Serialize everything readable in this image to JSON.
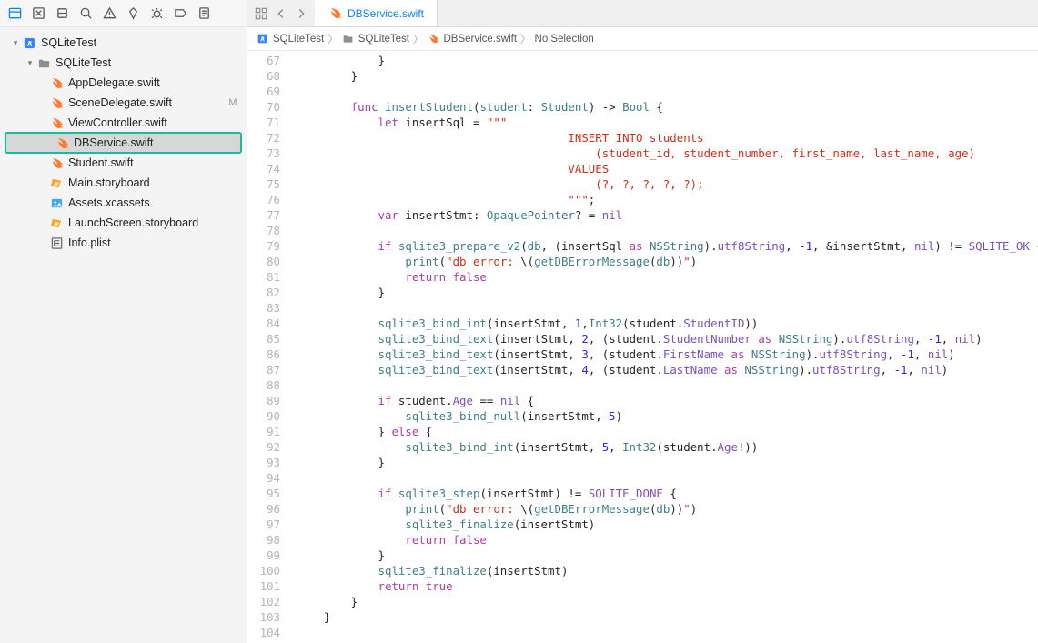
{
  "sidebar": {
    "project": "SQLiteTest",
    "group": "SQLiteTest",
    "files": [
      {
        "name": "AppDelegate.swift",
        "kind": "swift",
        "modified": false
      },
      {
        "name": "SceneDelegate.swift",
        "kind": "swift",
        "modified": true
      },
      {
        "name": "ViewController.swift",
        "kind": "swift",
        "modified": false
      },
      {
        "name": "DBService.swift",
        "kind": "swift",
        "modified": false,
        "selected": true,
        "highlight": true
      },
      {
        "name": "Student.swift",
        "kind": "swift",
        "modified": false
      },
      {
        "name": "Main.storyboard",
        "kind": "storyboard",
        "modified": false
      },
      {
        "name": "Assets.xcassets",
        "kind": "assets",
        "modified": false
      },
      {
        "name": "LaunchScreen.storyboard",
        "kind": "storyboard",
        "modified": false
      },
      {
        "name": "Info.plist",
        "kind": "plist",
        "modified": false
      }
    ]
  },
  "tab": {
    "label": "DBService.swift"
  },
  "breadcrumb": {
    "items": [
      {
        "label": "SQLiteTest",
        "icon": "project"
      },
      {
        "label": "SQLiteTest",
        "icon": "folder"
      },
      {
        "label": "DBService.swift",
        "icon": "swift"
      },
      {
        "label": "No Selection",
        "icon": null
      }
    ]
  },
  "editor": {
    "first_line_number": 67,
    "lines": [
      {
        "n": 67,
        "ind": 12,
        "tokens": [
          [
            "plain",
            "}"
          ]
        ]
      },
      {
        "n": 68,
        "ind": 8,
        "tokens": [
          [
            "plain",
            "}"
          ]
        ]
      },
      {
        "n": 69,
        "ind": 0,
        "tokens": []
      },
      {
        "n": 70,
        "ind": 8,
        "tokens": [
          [
            "kw",
            "func"
          ],
          [
            "plain",
            " "
          ],
          [
            "fn",
            "insertStudent"
          ],
          [
            "plain",
            "("
          ],
          [
            "fn",
            "student"
          ],
          [
            "plain",
            ": "
          ],
          [
            "type",
            "Student"
          ],
          [
            "plain",
            ") -> "
          ],
          [
            "type",
            "Bool"
          ],
          [
            "plain",
            " {"
          ]
        ]
      },
      {
        "n": 71,
        "ind": 12,
        "tokens": [
          [
            "kw",
            "let"
          ],
          [
            "plain",
            " insertSql = "
          ],
          [
            "str",
            "\"\"\""
          ]
        ]
      },
      {
        "n": 72,
        "ind": 40,
        "tokens": [
          [
            "str",
            "INSERT INTO students"
          ]
        ]
      },
      {
        "n": 73,
        "ind": 44,
        "tokens": [
          [
            "str",
            "(student_id, student_number, first_name, last_name, age)"
          ]
        ]
      },
      {
        "n": 74,
        "ind": 40,
        "tokens": [
          [
            "str",
            "VALUES"
          ]
        ]
      },
      {
        "n": 75,
        "ind": 44,
        "tokens": [
          [
            "str",
            "(?, ?, ?, ?, ?);"
          ]
        ]
      },
      {
        "n": 76,
        "ind": 40,
        "tokens": [
          [
            "str",
            "\"\"\""
          ],
          [
            "plain",
            ";"
          ]
        ]
      },
      {
        "n": 77,
        "ind": 12,
        "tokens": [
          [
            "kw",
            "var"
          ],
          [
            "plain",
            " insertStmt: "
          ],
          [
            "type",
            "OpaquePointer"
          ],
          [
            "plain",
            "? = "
          ],
          [
            "const",
            "nil"
          ]
        ]
      },
      {
        "n": 78,
        "ind": 0,
        "tokens": []
      },
      {
        "n": 79,
        "ind": 12,
        "tokens": [
          [
            "kw",
            "if"
          ],
          [
            "plain",
            " "
          ],
          [
            "fn",
            "sqlite3_prepare_v2"
          ],
          [
            "plain",
            "("
          ],
          [
            "fn",
            "db"
          ],
          [
            "plain",
            ", (insertSql "
          ],
          [
            "kw",
            "as"
          ],
          [
            "plain",
            " "
          ],
          [
            "type",
            "NSString"
          ],
          [
            "plain",
            ")."
          ],
          [
            "member",
            "utf8String"
          ],
          [
            "plain",
            ", "
          ],
          [
            "num",
            "-1"
          ],
          [
            "plain",
            ", &insertStmt, "
          ],
          [
            "const",
            "nil"
          ],
          [
            "plain",
            ") != "
          ],
          [
            "const",
            "SQLITE_OK"
          ],
          [
            "plain",
            " {"
          ]
        ]
      },
      {
        "n": 80,
        "ind": 16,
        "tokens": [
          [
            "fn",
            "print"
          ],
          [
            "plain",
            "("
          ],
          [
            "str",
            "\"db error: "
          ],
          [
            "plain",
            "\\("
          ],
          [
            "fn",
            "getDBErrorMessage"
          ],
          [
            "plain",
            "("
          ],
          [
            "fn",
            "db"
          ],
          [
            "plain",
            "))"
          ],
          [
            "str",
            "\""
          ],
          [
            "plain",
            ")"
          ]
        ]
      },
      {
        "n": 81,
        "ind": 16,
        "tokens": [
          [
            "kw",
            "return"
          ],
          [
            "plain",
            " "
          ],
          [
            "kw",
            "false"
          ]
        ]
      },
      {
        "n": 82,
        "ind": 12,
        "tokens": [
          [
            "plain",
            "}"
          ]
        ]
      },
      {
        "n": 83,
        "ind": 0,
        "tokens": []
      },
      {
        "n": 84,
        "ind": 12,
        "tokens": [
          [
            "fn",
            "sqlite3_bind_int"
          ],
          [
            "plain",
            "(insertStmt, "
          ],
          [
            "num",
            "1"
          ],
          [
            "plain",
            ","
          ],
          [
            "type",
            "Int32"
          ],
          [
            "plain",
            "(student."
          ],
          [
            "member",
            "StudentID"
          ],
          [
            "plain",
            "))"
          ]
        ]
      },
      {
        "n": 85,
        "ind": 12,
        "tokens": [
          [
            "fn",
            "sqlite3_bind_text"
          ],
          [
            "plain",
            "(insertStmt, "
          ],
          [
            "num",
            "2"
          ],
          [
            "plain",
            ", (student."
          ],
          [
            "member",
            "StudentNumber"
          ],
          [
            "plain",
            " "
          ],
          [
            "kw",
            "as"
          ],
          [
            "plain",
            " "
          ],
          [
            "type",
            "NSString"
          ],
          [
            "plain",
            ")."
          ],
          [
            "member",
            "utf8String"
          ],
          [
            "plain",
            ", "
          ],
          [
            "num",
            "-1"
          ],
          [
            "plain",
            ", "
          ],
          [
            "const",
            "nil"
          ],
          [
            "plain",
            ")"
          ]
        ]
      },
      {
        "n": 86,
        "ind": 12,
        "tokens": [
          [
            "fn",
            "sqlite3_bind_text"
          ],
          [
            "plain",
            "(insertStmt, "
          ],
          [
            "num",
            "3"
          ],
          [
            "plain",
            ", (student."
          ],
          [
            "member",
            "FirstName"
          ],
          [
            "plain",
            " "
          ],
          [
            "kw",
            "as"
          ],
          [
            "plain",
            " "
          ],
          [
            "type",
            "NSString"
          ],
          [
            "plain",
            ")."
          ],
          [
            "member",
            "utf8String"
          ],
          [
            "plain",
            ", "
          ],
          [
            "num",
            "-1"
          ],
          [
            "plain",
            ", "
          ],
          [
            "const",
            "nil"
          ],
          [
            "plain",
            ")"
          ]
        ]
      },
      {
        "n": 87,
        "ind": 12,
        "tokens": [
          [
            "fn",
            "sqlite3_bind_text"
          ],
          [
            "plain",
            "(insertStmt, "
          ],
          [
            "num",
            "4"
          ],
          [
            "plain",
            ", (student."
          ],
          [
            "member",
            "LastName"
          ],
          [
            "plain",
            " "
          ],
          [
            "kw",
            "as"
          ],
          [
            "plain",
            " "
          ],
          [
            "type",
            "NSString"
          ],
          [
            "plain",
            ")."
          ],
          [
            "member",
            "utf8String"
          ],
          [
            "plain",
            ", "
          ],
          [
            "num",
            "-1"
          ],
          [
            "plain",
            ", "
          ],
          [
            "const",
            "nil"
          ],
          [
            "plain",
            ")"
          ]
        ]
      },
      {
        "n": 88,
        "ind": 0,
        "tokens": []
      },
      {
        "n": 89,
        "ind": 12,
        "tokens": [
          [
            "kw",
            "if"
          ],
          [
            "plain",
            " student."
          ],
          [
            "member",
            "Age"
          ],
          [
            "plain",
            " == "
          ],
          [
            "const",
            "nil"
          ],
          [
            "plain",
            " {"
          ]
        ]
      },
      {
        "n": 90,
        "ind": 16,
        "tokens": [
          [
            "fn",
            "sqlite3_bind_null"
          ],
          [
            "plain",
            "(insertStmt, "
          ],
          [
            "num",
            "5"
          ],
          [
            "plain",
            ")"
          ]
        ]
      },
      {
        "n": 91,
        "ind": 12,
        "tokens": [
          [
            "plain",
            "} "
          ],
          [
            "kw",
            "else"
          ],
          [
            "plain",
            " {"
          ]
        ]
      },
      {
        "n": 92,
        "ind": 16,
        "tokens": [
          [
            "fn",
            "sqlite3_bind_int"
          ],
          [
            "plain",
            "(insertStmt, "
          ],
          [
            "num",
            "5"
          ],
          [
            "plain",
            ", "
          ],
          [
            "type",
            "Int32"
          ],
          [
            "plain",
            "(student."
          ],
          [
            "member",
            "Age"
          ],
          [
            "plain",
            "!))"
          ]
        ]
      },
      {
        "n": 93,
        "ind": 12,
        "tokens": [
          [
            "plain",
            "}"
          ]
        ]
      },
      {
        "n": 94,
        "ind": 0,
        "tokens": []
      },
      {
        "n": 95,
        "ind": 12,
        "tokens": [
          [
            "kw",
            "if"
          ],
          [
            "plain",
            " "
          ],
          [
            "fn",
            "sqlite3_step"
          ],
          [
            "plain",
            "(insertStmt) != "
          ],
          [
            "const",
            "SQLITE_DONE"
          ],
          [
            "plain",
            " {"
          ]
        ]
      },
      {
        "n": 96,
        "ind": 16,
        "tokens": [
          [
            "fn",
            "print"
          ],
          [
            "plain",
            "("
          ],
          [
            "str",
            "\"db error: "
          ],
          [
            "plain",
            "\\("
          ],
          [
            "fn",
            "getDBErrorMessage"
          ],
          [
            "plain",
            "("
          ],
          [
            "fn",
            "db"
          ],
          [
            "plain",
            "))"
          ],
          [
            "str",
            "\""
          ],
          [
            "plain",
            ")"
          ]
        ]
      },
      {
        "n": 97,
        "ind": 16,
        "tokens": [
          [
            "fn",
            "sqlite3_finalize"
          ],
          [
            "plain",
            "(insertStmt)"
          ]
        ]
      },
      {
        "n": 98,
        "ind": 16,
        "tokens": [
          [
            "kw",
            "return"
          ],
          [
            "plain",
            " "
          ],
          [
            "kw",
            "false"
          ]
        ]
      },
      {
        "n": 99,
        "ind": 12,
        "tokens": [
          [
            "plain",
            "}"
          ]
        ]
      },
      {
        "n": 100,
        "ind": 12,
        "tokens": [
          [
            "fn",
            "sqlite3_finalize"
          ],
          [
            "plain",
            "(insertStmt)"
          ]
        ]
      },
      {
        "n": 101,
        "ind": 12,
        "tokens": [
          [
            "kw",
            "return"
          ],
          [
            "plain",
            " "
          ],
          [
            "kw",
            "true"
          ]
        ]
      },
      {
        "n": 102,
        "ind": 8,
        "tokens": [
          [
            "plain",
            "}"
          ]
        ]
      },
      {
        "n": 103,
        "ind": 4,
        "tokens": [
          [
            "plain",
            "}"
          ]
        ]
      },
      {
        "n": 104,
        "ind": 0,
        "tokens": []
      }
    ]
  }
}
